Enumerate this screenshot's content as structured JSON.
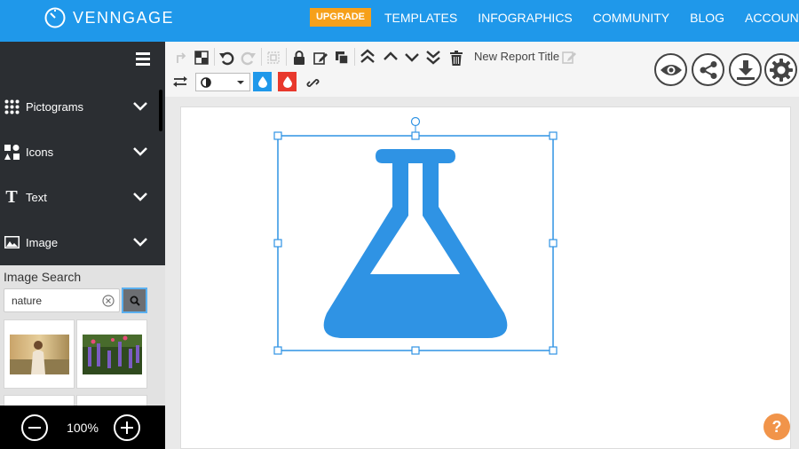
{
  "app": {
    "brand": "VENNGAGE",
    "upgrade_label": "UPGRADE",
    "nav": [
      "TEMPLATES",
      "INFOGRAPHICS",
      "COMMUNITY",
      "BLOG",
      "ACCOUNT"
    ]
  },
  "sidebar": {
    "sections": [
      {
        "label": "Pictograms",
        "icon": "grid-dots-icon"
      },
      {
        "label": "Icons",
        "icon": "shapes-icon"
      },
      {
        "label": "Text",
        "icon": "text-t-icon"
      },
      {
        "label": "Image",
        "icon": "image-icon"
      }
    ],
    "image_search": {
      "title": "Image Search",
      "query": "nature"
    },
    "zoom": "100%"
  },
  "toolbar": {
    "report_title": "New Report Title",
    "opacity_value": "",
    "colors": {
      "fill": "#1f98ea",
      "stroke": "#e8382c"
    }
  },
  "canvas": {
    "element": "flask-icon",
    "element_color": "#2f93e4",
    "selection_color": "#2f93e4"
  },
  "help_label": "?"
}
